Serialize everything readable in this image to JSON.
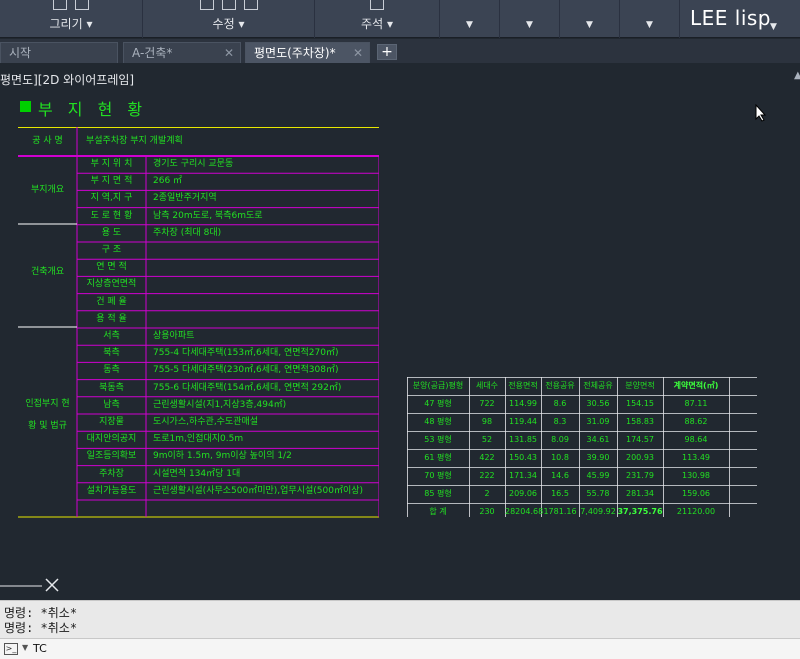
{
  "ribbon": {
    "panels": [
      {
        "label": "그리기"
      },
      {
        "label": "수정"
      },
      {
        "label": "주석"
      }
    ],
    "user_label": "LEE lisp"
  },
  "tabs": [
    {
      "label": "시작"
    },
    {
      "label": "A-건축*"
    },
    {
      "label": "평면도(주차장)*"
    }
  ],
  "viewport": {
    "label": "평면도][2D 와이어프레임]",
    "title": "부 지 현 황"
  },
  "site_table": {
    "header": [
      "공 사 명",
      "부설주차장 부지 개발계획"
    ],
    "groups": [
      {
        "name": "부지개요",
        "rows": [
          [
            "부 지 위 치",
            "경기도 구리시 교문동"
          ],
          [
            "부 지 면 적",
            "266 ㎡"
          ],
          [
            "지 역,지 구",
            "2종일반주거지역"
          ],
          [
            "도 로 현 황",
            "남측 20m도로, 북측6m도로"
          ]
        ]
      },
      {
        "name": "건축개요",
        "rows": [
          [
            "용      도",
            "주차장 (최대 8대)"
          ],
          [
            "구      조",
            ""
          ],
          [
            "연 면 적",
            ""
          ],
          [
            "지상층연면적",
            ""
          ],
          [
            "건 폐 율",
            ""
          ],
          [
            "용 적 율",
            ""
          ]
        ]
      },
      {
        "name": "인접부지 현황 및 법규",
        "rows": [
          [
            "서측",
            "상용아파트"
          ],
          [
            "북측",
            "755-4 다세대주택(153㎡,6세대, 연면적270㎡)"
          ],
          [
            "동측",
            "755-5 다세대주택(230㎡,6세대, 연면적308㎡)"
          ],
          [
            "북동측",
            "755-6 다세대주택(154㎡,6세대, 연면적 292㎡)"
          ],
          [
            "남측",
            "근린생활시설(지1,지상3층,494㎡)"
          ],
          [
            "지장물",
            "도시가스,하수관,수도관매설"
          ],
          [
            "대지안의공지",
            "도로1m,인접대지0.5m"
          ],
          [
            "일조등의확보",
            "9m이하 1.5m, 9m이상 높이의 1/2"
          ],
          [
            "주차장",
            "시설면적 134㎡당 1대"
          ],
          [
            "설치가능용도",
            "근린생활시설(사무소500㎡미만),업무시설(500㎡이상)"
          ]
        ]
      }
    ]
  },
  "summary_table": {
    "headers": [
      "분양(공급)평형",
      "세대수",
      "전용면적",
      "전용공유",
      "전체공유",
      "분양면적",
      "계약면적(㎡)"
    ],
    "rows": [
      [
        "47 평형",
        "722",
        "114.99",
        "8.6",
        "30.56",
        "154.15",
        "87.11"
      ],
      [
        "48 평형",
        "98",
        "119.44",
        "8.3",
        "31.09",
        "158.83",
        "88.62"
      ],
      [
        "53 평형",
        "52",
        "131.85",
        "8.09",
        "34.61",
        "174.57",
        "98.64"
      ],
      [
        "61 평형",
        "422",
        "150.43",
        "10.8",
        "39.90",
        "200.93",
        "113.49"
      ],
      [
        "70 평형",
        "222",
        "171.34",
        "14.6",
        "45.99",
        "231.79",
        "130.98"
      ],
      [
        "85 평형",
        "2",
        "209.06",
        "16.5",
        "55.78",
        "281.34",
        "159.06"
      ],
      [
        "합 계",
        "230",
        "28204.68",
        "1781.16",
        "7,409.92",
        "37,375.76",
        "21120.00"
      ]
    ]
  },
  "command": {
    "history": [
      "명령: *취소*",
      "명령: *취소*"
    ],
    "input": "TC"
  }
}
